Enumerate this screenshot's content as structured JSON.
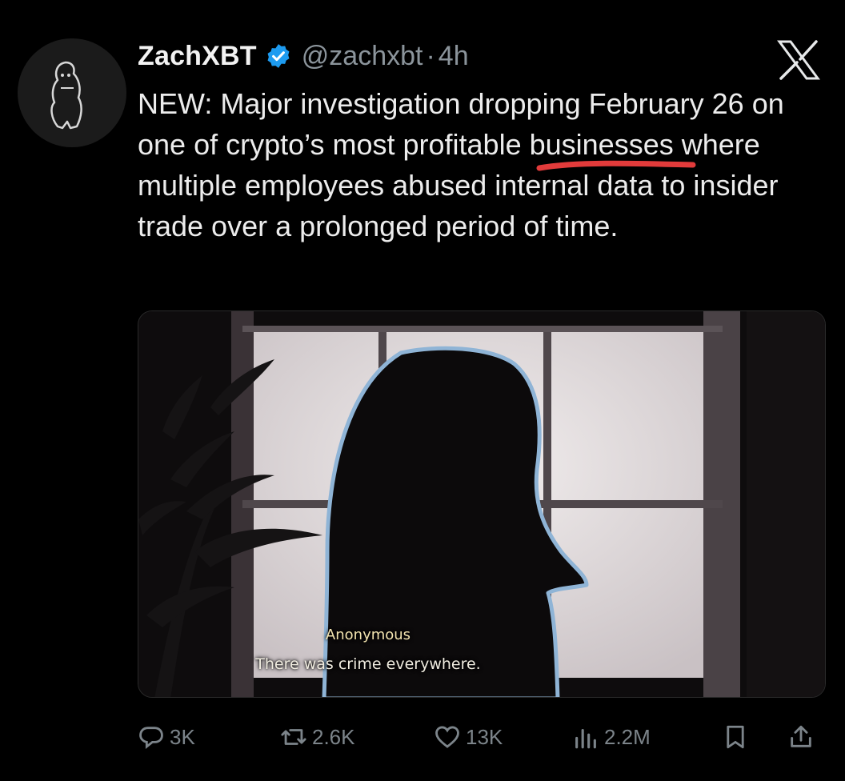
{
  "author": {
    "display_name": "ZachXBT",
    "handle": "@zachxbt",
    "separator": "·",
    "time_ago": "4h",
    "verified": true
  },
  "tweet": {
    "text_part1": "NEW: Major investigation dropping February 26 on one of crypto’s most ",
    "underlined_word": "profitable",
    "text_part2": " businesses where multiple employees abused internal data to insider trade over a prolonged period of time."
  },
  "media": {
    "caption_name": "Anonymous",
    "caption_line": "There was crime everywhere."
  },
  "actions": {
    "replies": "3K",
    "retweets": "2.6K",
    "likes": "13K",
    "views": "2.2M"
  },
  "icons": {
    "platform": "x-logo-icon",
    "reply": "reply-icon",
    "retweet": "retweet-icon",
    "like": "heart-icon",
    "views": "views-icon",
    "bookmark": "bookmark-icon",
    "share": "share-icon"
  },
  "colors": {
    "background": "#000000",
    "verified_badge": "#1d9bf0",
    "annotation_underline": "#e23b3b",
    "muted_text": "#8b949b"
  }
}
